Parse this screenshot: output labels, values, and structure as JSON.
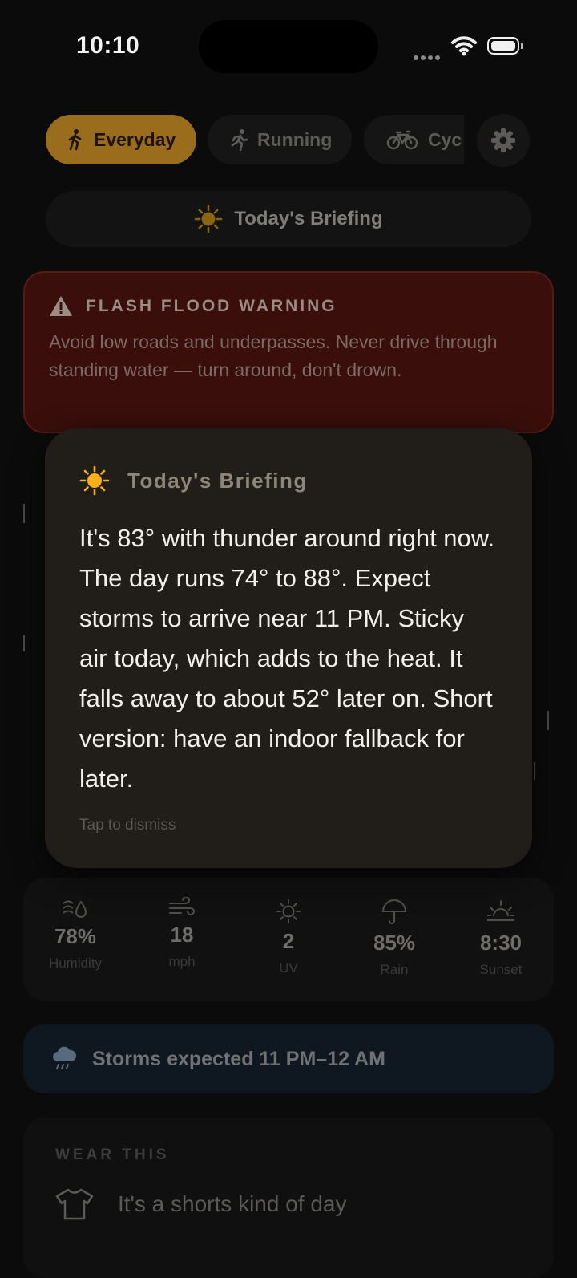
{
  "status_bar": {
    "time": "10:10"
  },
  "activity_tabs": [
    {
      "label": "Everyday",
      "active": true,
      "icon": "walking-icon"
    },
    {
      "label": "Running",
      "active": false,
      "icon": "running-icon"
    },
    {
      "label": "Cyc",
      "active": false,
      "icon": "bicycle-icon"
    }
  ],
  "briefing_button": {
    "label": "Today's Briefing",
    "icon": "sun-icon"
  },
  "alert": {
    "title": "FLASH FLOOD WARNING",
    "message": "Avoid low roads and underpasses. Never drive through standing water — turn around, don't drown.",
    "icon": "warning-icon"
  },
  "briefing_modal": {
    "title": "Today's Briefing",
    "text": "It's 83° with thunder around right now. The day runs 74° to 88°. Expect storms to arrive near 11 PM. Sticky air today, which adds to the heat. It falls away to about 52° later on. Short version: have an indoor fallback for later.",
    "dismiss_hint": "Tap to dismiss"
  },
  "stats": [
    {
      "value": "78%",
      "label": "Humidity",
      "icon": "humidity-icon"
    },
    {
      "value": "18",
      "label": "mph",
      "icon": "wind-icon"
    },
    {
      "value": "2",
      "label": "UV",
      "icon": "uv-sun-icon"
    },
    {
      "value": "85%",
      "label": "Rain",
      "icon": "umbrella-icon"
    },
    {
      "value": "8:30",
      "label": "Sunset",
      "icon": "sunset-icon"
    }
  ],
  "storm_notice": {
    "text": "Storms expected 11 PM–12 AM",
    "icon": "rain-cloud-icon"
  },
  "wear": {
    "heading": "WEAR THIS",
    "text": "It's a shorts kind of day",
    "icon": "tshirt-icon"
  },
  "colors": {
    "accent": "#9a6d1c",
    "alert_bg": "#3a0e0b",
    "card_bg": "#211e1a",
    "sun": "#f5b01a"
  }
}
